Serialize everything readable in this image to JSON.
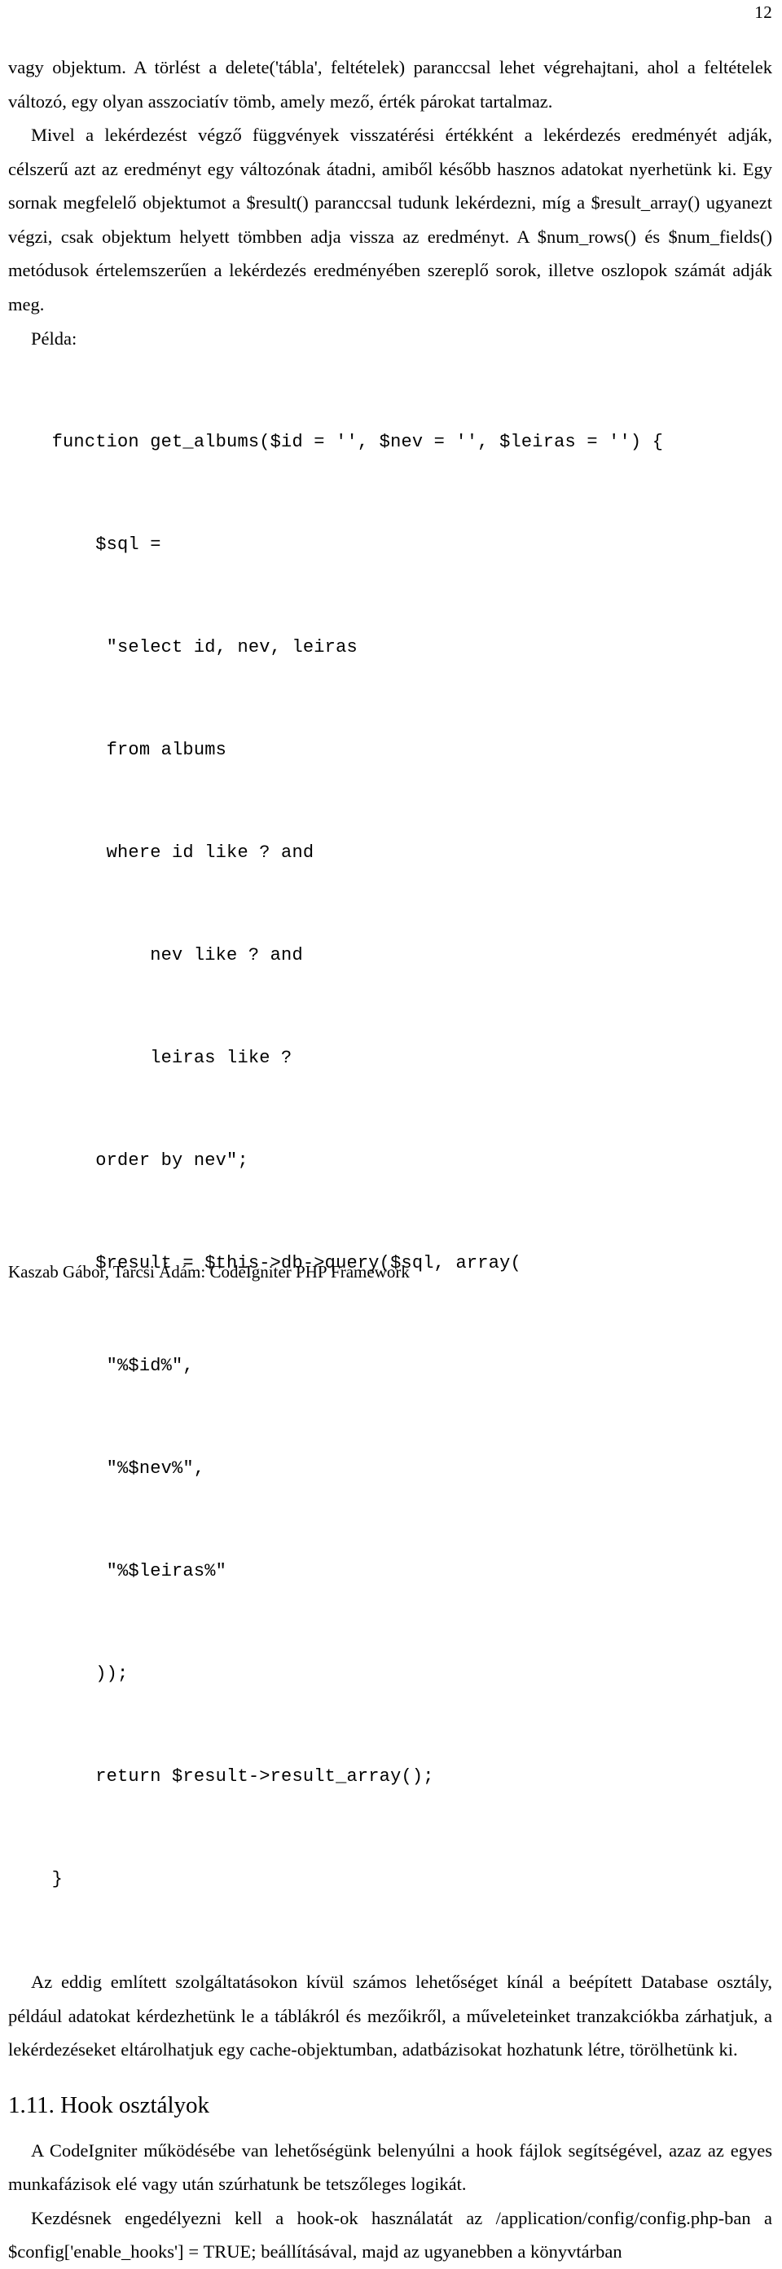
{
  "document": {
    "page_number": "12",
    "footer": "Kaszab Gábor, Tarcsi Ádám: CodeIgniter PHP Framework"
  },
  "content": {
    "paragraph_1": "vagy objektum. A törlést a delete('tábla', feltételek) paranccsal lehet végrehajtani, ahol a feltételek változó, egy olyan asszociatív tömb, amely mező, érték párokat tartalmaz.",
    "paragraph_2": "Mivel a lekérdezést végző függvények visszatérési értékként a lekérdezés eredményét adják, célszerű azt az eredményt egy változónak átadni, amiből később hasznos adatokat nyerhetünk ki. Egy sornak megfelelő objektumot a $result() paranccsal tudunk lekérdezni, míg a $result_array() ugyanezt végzi, csak objektum helyett tömbben adja vissza az eredményt. A $num_rows() és $num_fields() metódusok értelemszerűen a lekérdezés eredményében szereplő sorok, illetve oszlopok számát adják meg.",
    "example_label": "Példa:",
    "code_lines": [
      "    function get_albums($id = '', $nev = '', $leiras = '') {",
      "        $sql =",
      "         \"select id, nev, leiras",
      "         from albums",
      "         where id like ? and",
      "             nev like ? and",
      "             leiras like ?",
      "        order by nev\";",
      "        $result = $this->db->query($sql, array(",
      "         \"%$id%\",",
      "         \"%$nev%\",",
      "         \"%$leiras%\"",
      "        ));",
      "        return $result->result_array();",
      "    }"
    ],
    "paragraph_3": "Az eddig említett szolgáltatásokon kívül számos lehetőséget kínál a beépített Database osztály, például adatokat kérdezhetünk le a táblákról és mezőikről, a műveleteinket tranzakciókba zárhatjuk, a lekérdezéseket eltárolhatjuk egy cache-objektumban, adatbázisokat hozhatunk létre, törölhetünk ki.",
    "section_heading": "1.11. Hook osztályok",
    "paragraph_4": "A CodeIgniter működésébe van lehetőségünk belenyúlni a hook fájlok segítségével, azaz az egyes munkafázisok elé vagy után szúrhatunk be tetszőleges logikát.",
    "paragraph_5": "Kezdésnek engedélyezni kell a hook-ok használatát az /application/config/config.php-ban a $config['enable_hooks'] = TRUE; beállításával, majd az ugyanebben a könyvtárban"
  }
}
